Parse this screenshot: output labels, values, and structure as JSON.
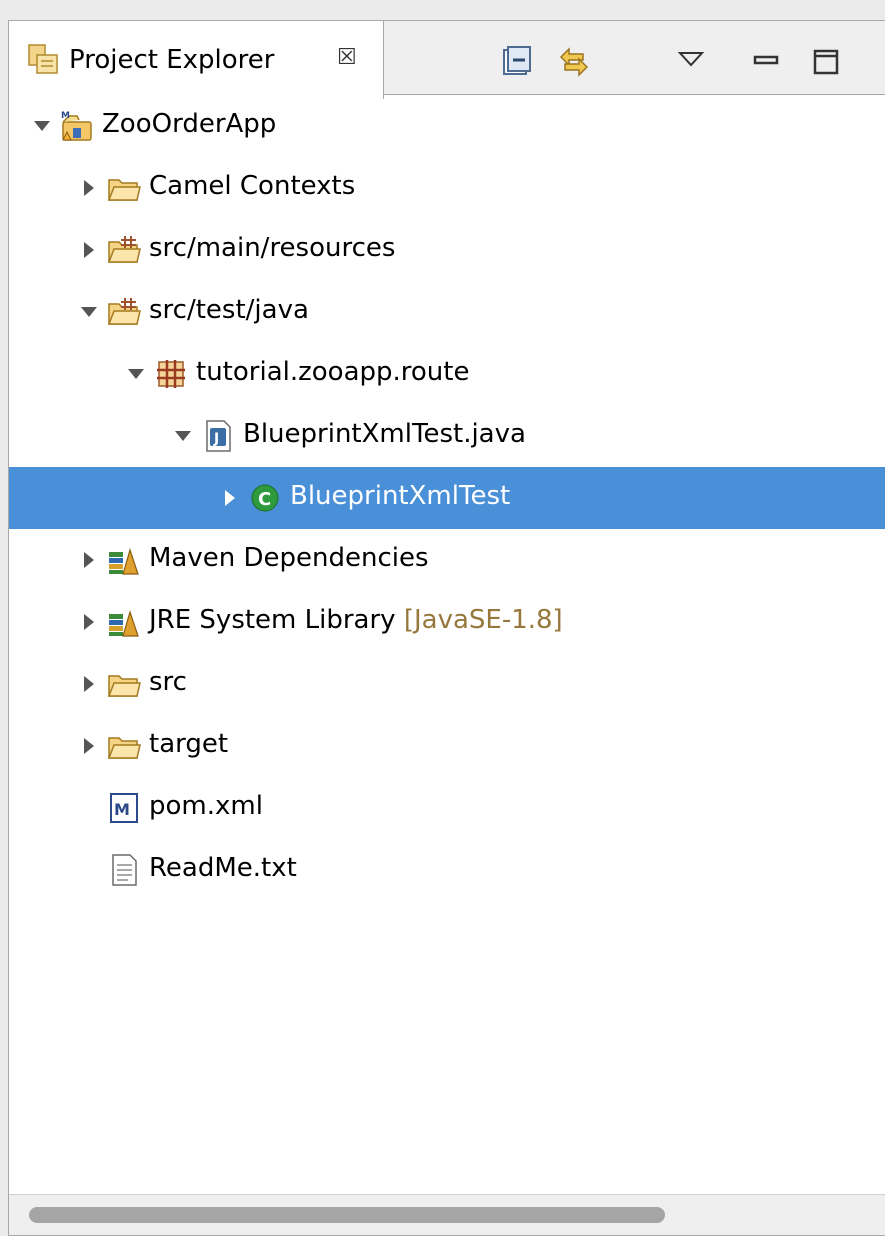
{
  "view": {
    "title": "Project Explorer",
    "close_glyph": "☒"
  },
  "toolbar": {
    "icons": [
      "collapse-all-icon",
      "link-with-editor-icon",
      "view-menu-icon",
      "minimize-icon",
      "maximize-icon"
    ]
  },
  "tree": [
    {
      "label": "ZooOrderApp",
      "indent": 0,
      "expanded": true,
      "icon": "maven-project-icon"
    },
    {
      "label": "Camel Contexts",
      "indent": 1,
      "expanded": false,
      "icon": "folder-icon"
    },
    {
      "label": "src/main/resources",
      "indent": 1,
      "expanded": false,
      "icon": "source-folder-icon"
    },
    {
      "label": "src/test/java",
      "indent": 1,
      "expanded": true,
      "icon": "source-folder-icon"
    },
    {
      "label": "tutorial.zooapp.route",
      "indent": 2,
      "expanded": true,
      "icon": "package-icon"
    },
    {
      "label": "BlueprintXmlTest.java",
      "indent": 3,
      "expanded": true,
      "icon": "java-file-icon"
    },
    {
      "label": "BlueprintXmlTest",
      "indent": 4,
      "expanded": false,
      "icon": "class-icon",
      "selected": true
    },
    {
      "label": "Maven Dependencies",
      "indent": 1,
      "expanded": false,
      "icon": "library-icon"
    },
    {
      "label": "JRE System Library",
      "decoration": "[JavaSE-1.8]",
      "indent": 1,
      "expanded": false,
      "icon": "library-icon"
    },
    {
      "label": "src",
      "indent": 1,
      "expanded": false,
      "icon": "folder-icon"
    },
    {
      "label": "target",
      "indent": 1,
      "expanded": false,
      "icon": "folder-icon"
    },
    {
      "label": "pom.xml",
      "indent": 1,
      "expanded": null,
      "icon": "maven-pom-icon"
    },
    {
      "label": "ReadMe.txt",
      "indent": 1,
      "expanded": null,
      "icon": "text-file-icon"
    }
  ],
  "colors": {
    "selection": "#4a90d9",
    "decoration": "#96783c"
  }
}
